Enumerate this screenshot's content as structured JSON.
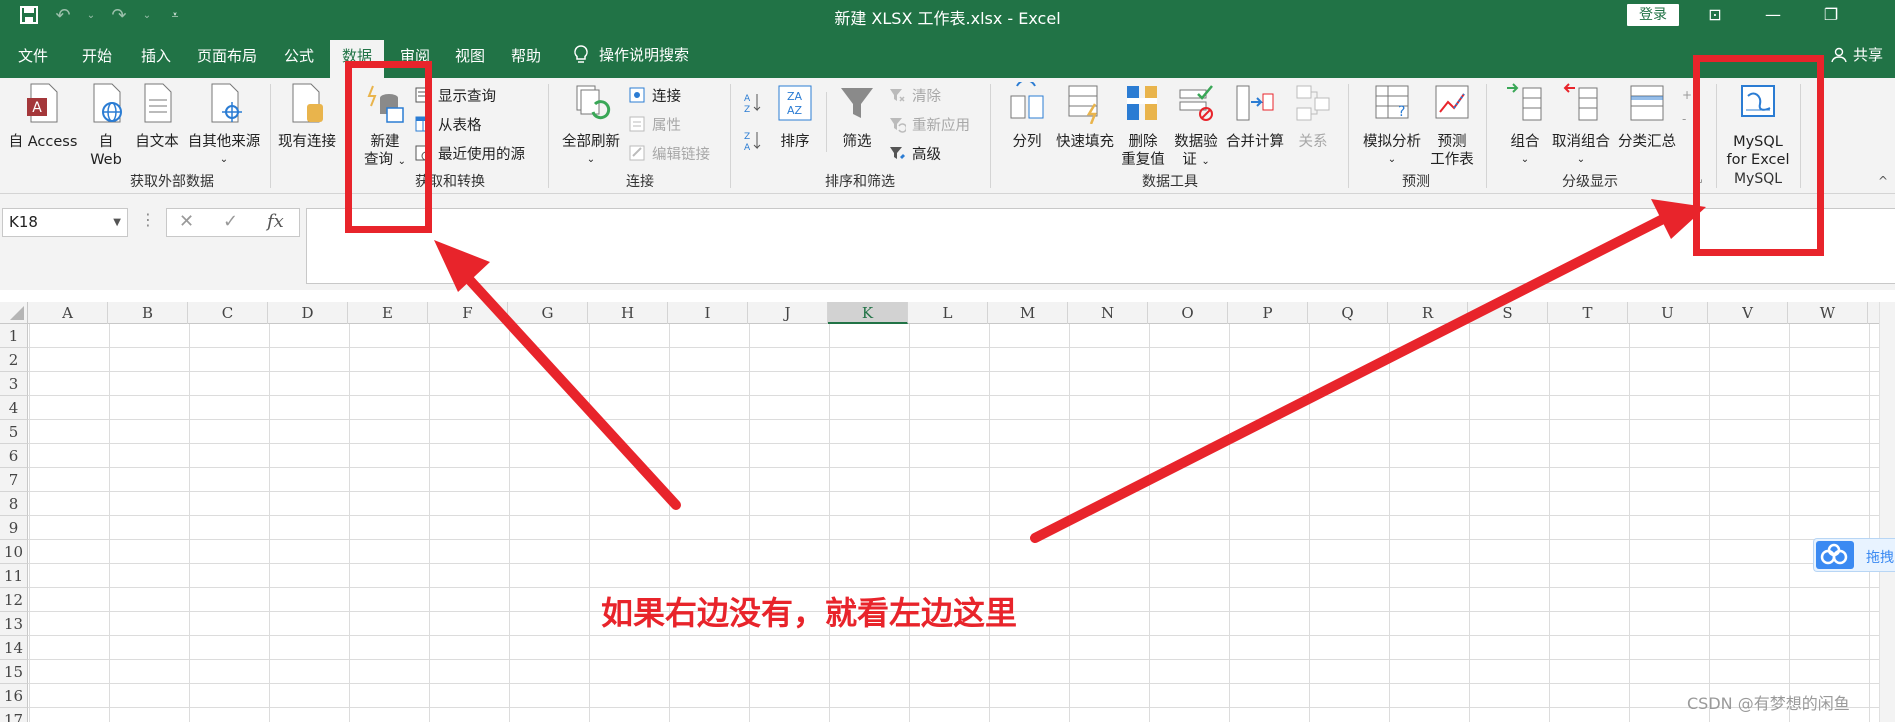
{
  "window": {
    "title": "新建 XLSX 工作表.xlsx  -  Excel",
    "login_label": "登录",
    "share_label": "共享"
  },
  "tabs": [
    {
      "label": "文件",
      "active": false
    },
    {
      "label": "开始",
      "active": false
    },
    {
      "label": "插入",
      "active": false
    },
    {
      "label": "页面布局",
      "active": false
    },
    {
      "label": "公式",
      "active": false
    },
    {
      "label": "数据",
      "active": true
    },
    {
      "label": "审阅",
      "active": false
    },
    {
      "label": "视图",
      "active": false
    },
    {
      "label": "帮助",
      "active": false
    }
  ],
  "tell_me": "操作说明搜索",
  "ribbon": {
    "get_external": {
      "label": "获取外部数据",
      "access": "自 Access",
      "web_line1": "自",
      "web_line2": "Web",
      "text": "自文本",
      "other": "自其他来源",
      "existing": "现有连接"
    },
    "get_transform": {
      "label": "获取和转换",
      "new_query_line1": "新建",
      "new_query_line2": "查询",
      "show_queries": "显示查询",
      "from_table": "从表格",
      "recent_sources": "最近使用的源"
    },
    "connections": {
      "label": "连接",
      "refresh_all": "全部刷新",
      "connections": "连接",
      "properties": "属性",
      "edit_links": "编辑链接"
    },
    "sort_filter": {
      "label": "排序和筛选",
      "sort": "排序",
      "filter": "筛选",
      "clear": "清除",
      "reapply": "重新应用",
      "advanced": "高级"
    },
    "data_tools": {
      "label": "数据工具",
      "text_to_columns": "分列",
      "flash_fill": "快速填充",
      "remove_dup_line1": "删除",
      "remove_dup_line2": "重复值",
      "validation_line1": "数据验",
      "validation_line2": "证",
      "consolidate": "合并计算",
      "relationships": "关系"
    },
    "forecast": {
      "label": "预测",
      "what_if": "模拟分析",
      "sheet_line1": "预测",
      "sheet_line2": "工作表"
    },
    "outline": {
      "label": "分级显示",
      "group": "组合",
      "ungroup": "取消组合",
      "subtotal": "分类汇总"
    },
    "mysql": {
      "label": "MySQL",
      "btn_line1": "MySQL",
      "btn_line2": "for Excel"
    }
  },
  "formula_bar": {
    "name_box": "K18",
    "fx": "fx"
  },
  "grid": {
    "columns": [
      "A",
      "B",
      "C",
      "D",
      "E",
      "F",
      "G",
      "H",
      "I",
      "J",
      "K",
      "L",
      "M",
      "N",
      "O",
      "P",
      "Q",
      "R",
      "S",
      "T",
      "U",
      "V",
      "W"
    ],
    "selected_column": "K",
    "rows": [
      "1",
      "2",
      "3",
      "4",
      "5",
      "6",
      "7",
      "8",
      "9",
      "10",
      "11",
      "12",
      "13",
      "14",
      "15",
      "16",
      "17"
    ]
  },
  "annotation": {
    "text": "如果右边没有，就看左边这里",
    "color": "#e8242b"
  },
  "float_tool_label": "拖拽",
  "watermark": "CSDN @有梦想的闲鱼",
  "colors": {
    "excel_green": "#217346",
    "ribbon_bg": "#f3f3f3"
  }
}
